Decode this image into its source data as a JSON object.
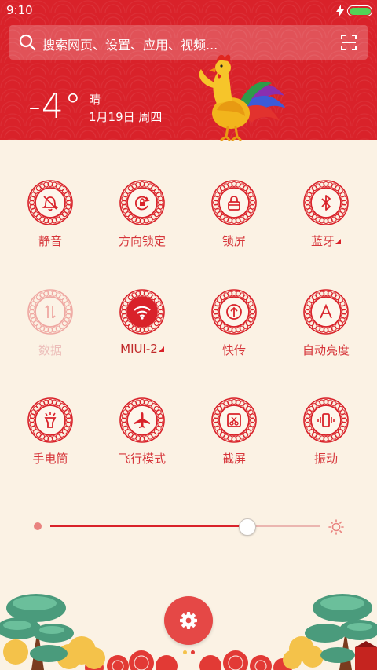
{
  "status_bar": {
    "time": "9:10"
  },
  "search": {
    "placeholder": "搜索网页、设置、应用、视频..."
  },
  "weather": {
    "temperature": "-4°",
    "condition": "晴",
    "date": "1月19日 周四"
  },
  "tiles": [
    {
      "label": "静音",
      "icon": "bell-off-icon",
      "state": "on"
    },
    {
      "label": "方向锁定",
      "icon": "rotation-lock-icon",
      "state": "on"
    },
    {
      "label": "锁屏",
      "icon": "lock-icon",
      "state": "on"
    },
    {
      "label": "蓝牙",
      "icon": "bluetooth-icon",
      "state": "on",
      "has_more": true
    },
    {
      "label": "数据",
      "icon": "data-icon",
      "state": "disabled"
    },
    {
      "label": "MIUI-2",
      "icon": "wifi-icon",
      "state": "active",
      "has_more": true
    },
    {
      "label": "快传",
      "icon": "transfer-icon",
      "state": "on"
    },
    {
      "label": "自动亮度",
      "icon": "auto-brightness-icon",
      "state": "on"
    },
    {
      "label": "手电筒",
      "icon": "flashlight-icon",
      "state": "on"
    },
    {
      "label": "飞行模式",
      "icon": "airplane-icon",
      "state": "on"
    },
    {
      "label": "截屏",
      "icon": "screenshot-icon",
      "state": "on"
    },
    {
      "label": "振动",
      "icon": "vibrate-icon",
      "state": "on"
    }
  ],
  "brightness": {
    "level": 0.73
  },
  "pager": {
    "pages": 2,
    "current": 1
  },
  "colors": {
    "accent": "#d9222a",
    "background": "#fbf2e4",
    "battery": "#52d357"
  }
}
